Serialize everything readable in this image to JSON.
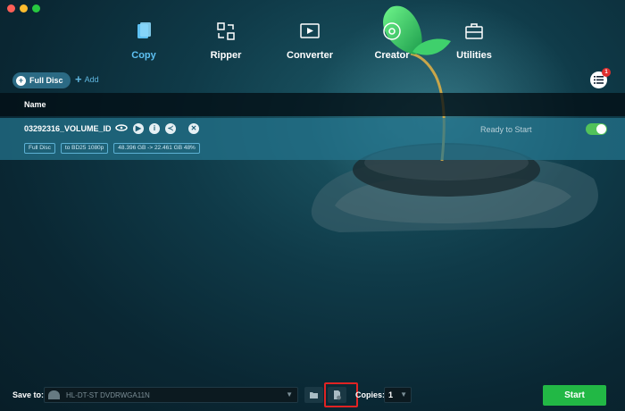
{
  "toolbar": {
    "items": [
      {
        "label": "Copy",
        "icon": "copy-icon",
        "active": true
      },
      {
        "label": "Ripper",
        "icon": "ripper-icon",
        "active": false
      },
      {
        "label": "Converter",
        "icon": "converter-icon",
        "active": false
      },
      {
        "label": "Creator",
        "icon": "creator-icon",
        "active": false
      },
      {
        "label": "Utilities",
        "icon": "utilities-icon",
        "active": false
      }
    ]
  },
  "sub_bar": {
    "full_disc_label": "Full Disc",
    "add_label": "Add",
    "queue_badge": "1"
  },
  "list": {
    "name_header": "Name",
    "item": {
      "volume_id": "03292316_VOLUME_ID",
      "status": "Ready to Start",
      "enabled": true,
      "chips": [
        "Full Disc",
        "to BD25 1080p",
        "48.396 GB -> 22.461 GB 48%"
      ]
    }
  },
  "footer": {
    "save_to_label": "Save to:",
    "save_to_value": "HL-DT-ST DVDRWGA11N",
    "copies_label": "Copies:",
    "copies_value": "1",
    "start_label": "Start"
  },
  "colors": {
    "accent": "#5ec1f3",
    "start_button": "#22b845",
    "highlight_box": "#e02323",
    "toggle_on": "#52c25a"
  }
}
